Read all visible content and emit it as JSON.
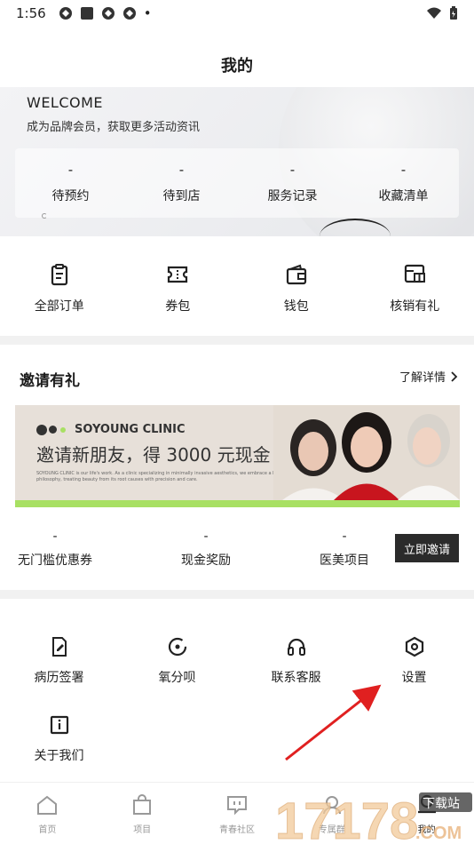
{
  "status_bar": {
    "time": "1:56",
    "dot": "•"
  },
  "page_title": "我的",
  "hero": {
    "welcome": "WELCOME",
    "subtitle": "成为品牌会员，获取更多活动资讯",
    "stats": [
      {
        "value": "-",
        "label": "待预约"
      },
      {
        "value": "-",
        "label": "待到店"
      },
      {
        "value": "-",
        "label": "服务记录"
      },
      {
        "value": "-",
        "label": "收藏清单"
      }
    ]
  },
  "quick_actions": [
    {
      "label": "全部订单",
      "icon": "clipboard-icon"
    },
    {
      "label": "券包",
      "icon": "ticket-icon"
    },
    {
      "label": "钱包",
      "icon": "wallet-icon"
    },
    {
      "label": "核销有礼",
      "icon": "gift-scan-icon"
    }
  ],
  "invite": {
    "title": "邀请有礼",
    "more_label": "了解详情",
    "banner": {
      "brand": "SOYOUNG CLINIC",
      "headline": "邀请新朋友，得 3000 元现金",
      "fine_print": "SOYOUNG CLINIC is our life's work. As a clinic specializing in minimally invasive aesthetics, we embrace a holistic philosophy, treating beauty from its root causes with precision and care."
    },
    "rewards": [
      {
        "value": "-",
        "label": "无门槛优惠券"
      },
      {
        "value": "-",
        "label": "现金奖励"
      },
      {
        "value": "-",
        "label": "医美项目"
      }
    ],
    "button_label": "立即邀请"
  },
  "services": [
    {
      "label": "病历签署",
      "icon": "document-sign-icon"
    },
    {
      "label": "氧分呗",
      "icon": "oxygen-icon"
    },
    {
      "label": "联系客服",
      "icon": "headphones-icon"
    },
    {
      "label": "设置",
      "icon": "settings-icon"
    },
    {
      "label": "关于我们",
      "icon": "info-icon"
    }
  ],
  "tabbar": [
    {
      "label": "首页",
      "icon": "home-icon"
    },
    {
      "label": "项目",
      "icon": "bag-icon"
    },
    {
      "label": "青春社区",
      "icon": "community-icon"
    },
    {
      "label": "专属群",
      "icon": "group-icon"
    },
    {
      "label": "我的",
      "icon": "profile-icon"
    }
  ],
  "watermark": {
    "text": "17178",
    "sub": "下载站",
    "domain": ".COM"
  },
  "colors": {
    "accent_green": "#a8e063",
    "button_dark": "#2b2b2b",
    "arrow_red": "#e02020"
  }
}
